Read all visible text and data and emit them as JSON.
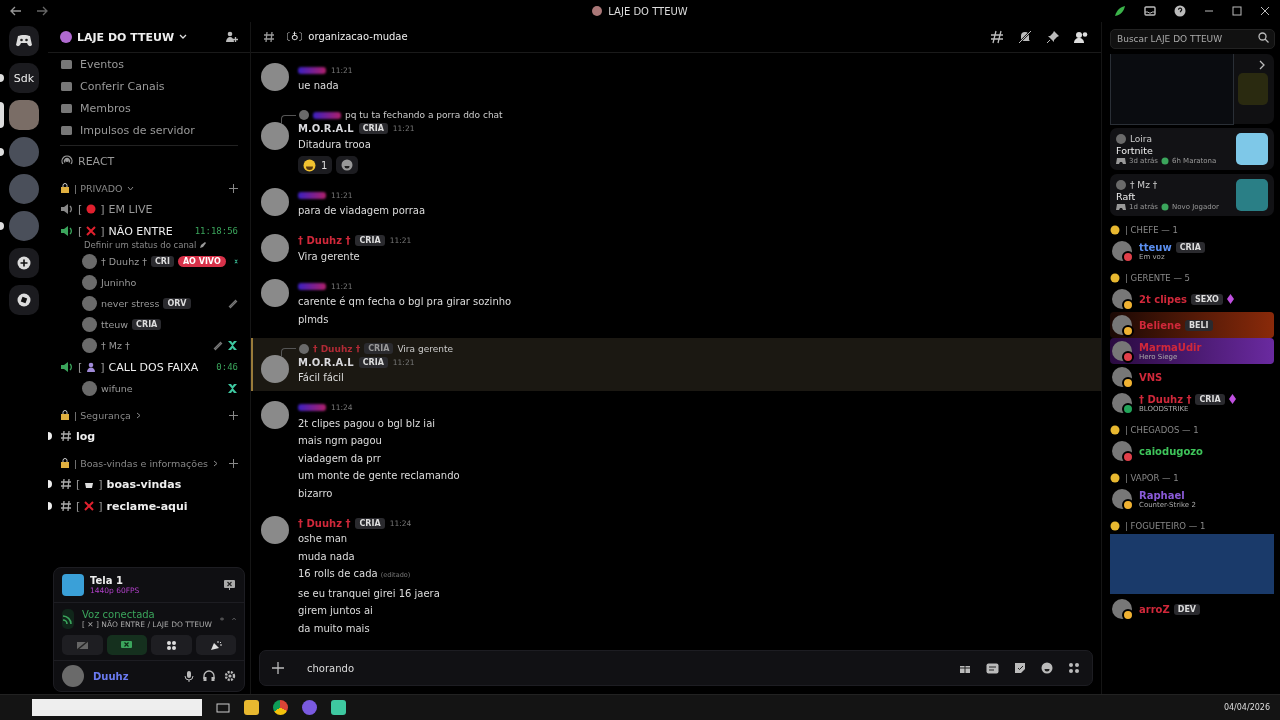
{
  "title_bar": {
    "title": "LAJE DO TTEUW"
  },
  "servers": [
    {
      "kind": "home",
      "unread": false,
      "selected": false
    },
    {
      "kind": "text",
      "label": "Sdk",
      "unread": true,
      "selected": false
    },
    {
      "kind": "avatar",
      "unread": false,
      "selected": true
    },
    {
      "kind": "avatar",
      "unread": true,
      "selected": false
    },
    {
      "kind": "avatar",
      "unread": false,
      "selected": false
    },
    {
      "kind": "avatar",
      "unread": true,
      "selected": false
    },
    {
      "kind": "add",
      "unread": false,
      "selected": false
    },
    {
      "kind": "explore",
      "unread": false,
      "selected": false
    }
  ],
  "sidebar": {
    "server_name": "LAJE DO TTEUW",
    "menu": [
      {
        "label": "Eventos"
      },
      {
        "label": "Conferir Canais"
      },
      {
        "label": "Membros"
      },
      {
        "label": "Impulsos de servidor"
      }
    ],
    "channels": [
      {
        "kind": "stage",
        "label": "REACT"
      },
      {
        "kind": "category",
        "label": "| PRIVADO",
        "collapsed": false
      },
      {
        "kind": "voice",
        "pre": "[",
        "post": "]",
        "emblem": {
          "kind": "dot"
        },
        "label": "EM LIVE",
        "connected": false
      },
      {
        "kind": "voice",
        "pre": "[",
        "post": "]",
        "emblem": {
          "kind": "cross"
        },
        "label": "NÃO ENTRE",
        "connected": true,
        "timer": "11:18:56",
        "status": "Definir um status do canal"
      },
      {
        "kind": "user",
        "name": "† Duuhz †",
        "tag": "CRI",
        "live": "AO VIVO",
        "app": true,
        "muted": false
      },
      {
        "kind": "user",
        "name": "Juninho",
        "app": false,
        "muted": false
      },
      {
        "kind": "user",
        "name": "never stress",
        "tag": "ORV",
        "app": false,
        "muted": true
      },
      {
        "kind": "user",
        "name": "tteuw",
        "tag": "CRIA",
        "app": false,
        "muted": false
      },
      {
        "kind": "user",
        "name": "† Mz †",
        "app": true,
        "muted": true
      },
      {
        "kind": "voice",
        "pre": "[",
        "post": "]",
        "emblem": {
          "kind": "person"
        },
        "label": "CALL DOS FAIXA",
        "connected": true,
        "timer": "0:46"
      },
      {
        "kind": "user",
        "name": "wifune",
        "app": true,
        "muted": false
      },
      {
        "kind": "category",
        "label": "| Segurança",
        "collapsed": true
      },
      {
        "kind": "text",
        "label": "log",
        "unread": true
      },
      {
        "kind": "category",
        "label": "| Boas-vindas e informações",
        "collapsed": true
      },
      {
        "kind": "text",
        "pre": "[",
        "post": "]",
        "emblem": {
          "kind": "cup"
        },
        "label": "boas-vindas",
        "unread": true
      },
      {
        "kind": "text",
        "pre": "[",
        "post": "]",
        "emblem": {
          "kind": "cross"
        },
        "label": "reclame-aqui",
        "unread": true
      }
    ]
  },
  "voice_panel": {
    "stream_title": "Tela 1",
    "stream_quality": "1440p 60FPS",
    "status": "Voz conectada",
    "location": "[ ✕ ] NÃO ENTRE / LAJE DO TTEUW",
    "user": "Duuhz"
  },
  "channel_header": {
    "name": "〔♁〕organizacao-mudae",
    "search": {
      "placeholder": "Buscar LAJE DO TTEUW"
    }
  },
  "messages": [
    {
      "redacted": true,
      "time": "11:21",
      "lines": [
        {
          "text": "ue nada"
        }
      ]
    },
    {
      "reply": {
        "redacted": true,
        "text": "pq tu ta fechando a porra ddo chat"
      },
      "author": "M.O.R.A.L",
      "color": "#d8d8dc",
      "tag": "CRIA",
      "time": "11:21",
      "lines": [
        {
          "text": "Ditadura trooa"
        }
      ],
      "reactions": [
        {
          "count": "1"
        }
      ]
    },
    {
      "redacted": true,
      "time": "11:21",
      "lines": [
        {
          "text": "para de viadagem porraa"
        }
      ]
    },
    {
      "author": "† Duuhz †",
      "color": "#d0283a",
      "tag": "CRIA",
      "time": "11:21",
      "lines": [
        {
          "text": "Vira gerente"
        }
      ]
    },
    {
      "redacted": true,
      "time": "11:21",
      "lines": [
        {
          "text": "carente é qm fecha o bgl pra girar sozinho"
        },
        {
          "text": "plmds"
        }
      ]
    },
    {
      "highlighted": true,
      "reply": {
        "author": "† Duuhz †",
        "tag": "CRIA",
        "text": "Vira gerente"
      },
      "author": "M.O.R.A.L",
      "color": "#d8d8dc",
      "tag": "CRIA",
      "time": "11:21",
      "lines": [
        {
          "text": "Fácil fácil"
        }
      ]
    },
    {
      "redacted": true,
      "time": "11:24",
      "lines": [
        {
          "text": "2t clipes pagou o bgl blz iai"
        },
        {
          "text": "mais ngm pagou"
        },
        {
          "text": "viadagem da prr"
        },
        {
          "text": "um monte de gente reclamando"
        },
        {
          "text": "bizarro"
        }
      ]
    },
    {
      "author": "† Duuhz †",
      "color": "#d0283a",
      "tag": "CRIA",
      "time": "11:24",
      "lines": [
        {
          "text": "oshe man"
        },
        {
          "text": "muda nada"
        },
        {
          "text": "16 rolls de cada",
          "note": "(editado)"
        },
        {
          "text": "se eu tranquei girei 16 jaera"
        },
        {
          "text": "girem juntos ai"
        },
        {
          "text": "da muito mais"
        }
      ]
    }
  ],
  "composer": {
    "value": "chorando"
  },
  "activities": [
    {
      "kind": "preview"
    },
    {
      "kind": "game",
      "user": "Loira",
      "game": "Fortnite",
      "ago": "3d atrás",
      "extra": "6h Maratona",
      "color": "#7ec8e8"
    },
    {
      "kind": "game",
      "user": "† Mz †",
      "game": "Raft",
      "ago": "1d atrás",
      "extra": "Novo Jogador",
      "color": "#2a7f86"
    }
  ],
  "member_groups": [
    {
      "label": "| CHEFE — 1",
      "members": [
        {
          "name": "tteuw",
          "color": "#5b8ff0",
          "tag": "CRIA",
          "status": "Em voz",
          "presence": {
            "kind": "dnd"
          }
        }
      ]
    },
    {
      "label": "| GERENTE — 5",
      "members": [
        {
          "name": "2t clipes",
          "color": "#d0283a",
          "tag": "SEXO",
          "boost": true,
          "presence": {
            "kind": "idle"
          }
        },
        {
          "name": "Beliene",
          "color": "#d0283a",
          "tag": "BELI",
          "banner": {
            "kind": "fire"
          },
          "presence": {
            "kind": "idle"
          }
        },
        {
          "name": "MarmaUdir",
          "color": "#d0283a",
          "status": "Hero Siege",
          "banner": {
            "kind": "purple"
          },
          "presence": {
            "kind": "dnd"
          }
        },
        {
          "name": "VNS",
          "color": "#d0283a",
          "presence": {
            "kind": "idle"
          }
        },
        {
          "name": "† Duuhz †",
          "color": "#d0283a",
          "tag": "CRIA",
          "boost": true,
          "status": "BLOODSTRIKE",
          "presence": {
            "kind": "mobile"
          }
        }
      ]
    },
    {
      "label": "| CHEGADOS — 1",
      "members": [
        {
          "name": "caiodugozo",
          "color": "#3ec45a",
          "presence": {
            "kind": "dnd"
          }
        }
      ]
    },
    {
      "label": "| VAPOR — 1",
      "members": [
        {
          "name": "Raphael",
          "color": "#8a5ad8",
          "status": "Counter-Strike 2",
          "presence": {
            "kind": "idle"
          }
        }
      ]
    },
    {
      "label": "| FOGUETEIRO — 1",
      "members": [
        {
          "name": "arroZ",
          "color": "#d0283a",
          "tag": "DEV",
          "photo_banner": true,
          "presence": {
            "kind": "idle"
          }
        }
      ]
    }
  ],
  "taskbar": {
    "date": "04/04/2026"
  }
}
